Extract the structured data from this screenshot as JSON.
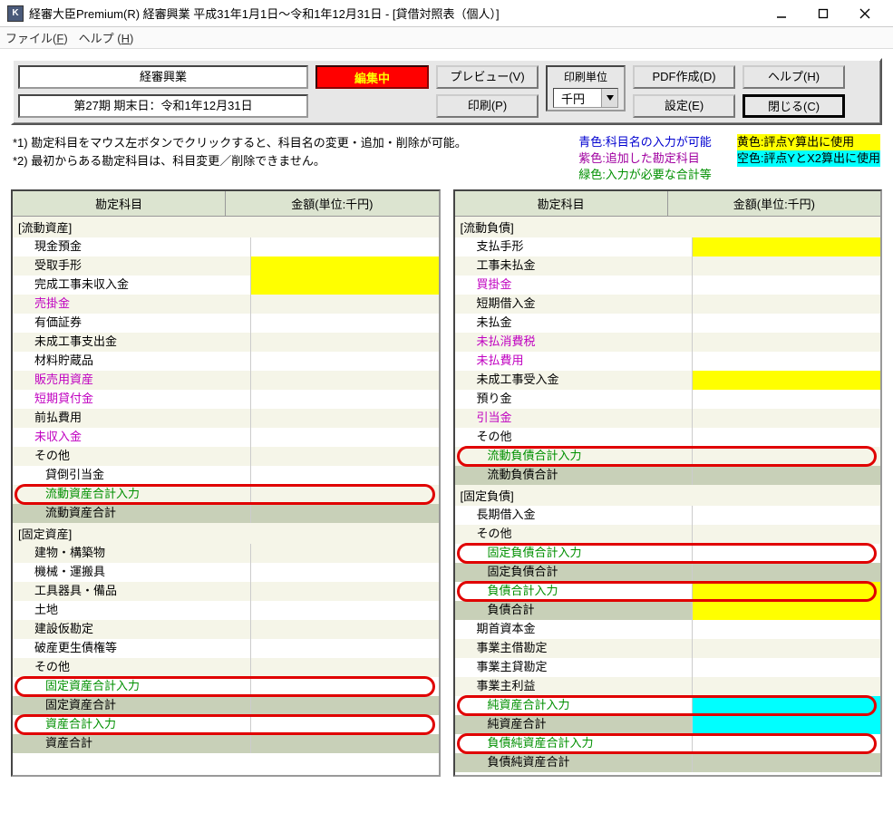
{
  "window": {
    "app_icon_letter": "K",
    "title": "経審大臣Premium(R)   経審興業    平成31年1月1日～令和1年12月31日 - [貸借対照表（個人）]"
  },
  "menubar": {
    "file": "ファイル",
    "file_acc": "F",
    "help": "ヘルプ",
    "help_acc": "H"
  },
  "toolbar": {
    "company": "経審興業",
    "period": "第27期   期末日：令和1年12月31日",
    "editing": "編集中",
    "preview": "プレビュー(V)",
    "print": "印刷(P)",
    "unit_label": "印刷単位",
    "unit_value": "千円",
    "pdf": "PDF作成(D)",
    "settings": "設定(E)",
    "helpbtn": "ヘルプ(H)",
    "close": "閉じる(C)"
  },
  "notes": {
    "n1": "*1) 勘定科目をマウス左ボタンでクリックすると、科目名の変更・追加・削除が可能。",
    "n2": "*2) 最初からある勘定科目は、科目変更／削除できません。"
  },
  "legend": {
    "blue": "青色:科目名の入力が可能",
    "purple": "紫色:追加した勘定科目",
    "green": "緑色:入力が必要な合計等",
    "yellow": "黄色:評点Y算出に使用",
    "cyan": "空色:評点YとX2算出に使用"
  },
  "table_header": {
    "account": "勘定科目",
    "amount": "金額(単位:千円)"
  },
  "left_pane": {
    "sections": [
      {
        "title": "[流動資産]",
        "rows": [
          {
            "label": "現金預金",
            "alt": false
          },
          {
            "label": "受取手形",
            "alt": true,
            "amount_bg": "yellow"
          },
          {
            "label": "完成工事未収入金",
            "alt": false,
            "amount_bg": "yellow"
          },
          {
            "label": "売掛金",
            "alt": true,
            "color": "purple"
          },
          {
            "label": "有価証券",
            "alt": false
          },
          {
            "label": "未成工事支出金",
            "alt": true
          },
          {
            "label": "材料貯蔵品",
            "alt": false
          },
          {
            "label": "販売用資産",
            "alt": true,
            "color": "purple"
          },
          {
            "label": "短期貸付金",
            "alt": false,
            "color": "purple"
          },
          {
            "label": "前払費用",
            "alt": true
          },
          {
            "label": "未収入金",
            "alt": false,
            "color": "purple"
          },
          {
            "label": "その他",
            "alt": true
          },
          {
            "label": "貸倒引当金",
            "alt": false,
            "indent": 2
          },
          {
            "label": "流動資産合計入力",
            "alt": true,
            "color": "green",
            "indent": 2,
            "oval": true
          },
          {
            "label": "流動資産合計",
            "summary": true,
            "indent": 2
          }
        ]
      },
      {
        "title": "[固定資産]",
        "rows": [
          {
            "label": "建物・構築物",
            "alt": true
          },
          {
            "label": "機械・運搬具",
            "alt": false
          },
          {
            "label": "工具器具・備品",
            "alt": true
          },
          {
            "label": "土地",
            "alt": false
          },
          {
            "label": "建設仮勘定",
            "alt": true
          },
          {
            "label": "破産更生債権等",
            "alt": false
          },
          {
            "label": "その他",
            "alt": true
          },
          {
            "label": "固定資産合計入力",
            "alt": false,
            "color": "green",
            "indent": 2,
            "oval": true
          },
          {
            "label": "固定資産合計",
            "summary": true,
            "indent": 2
          },
          {
            "label": "資産合計入力",
            "alt": false,
            "color": "green",
            "indent": 2,
            "oval": true
          },
          {
            "label": "資産合計",
            "summary": true,
            "indent": 2
          }
        ]
      }
    ]
  },
  "right_pane": {
    "sections": [
      {
        "title": "[流動負債]",
        "rows": [
          {
            "label": "支払手形",
            "alt": false,
            "amount_bg": "yellow"
          },
          {
            "label": "工事未払金",
            "alt": true
          },
          {
            "label": "買掛金",
            "alt": false,
            "color": "purple"
          },
          {
            "label": "短期借入金",
            "alt": true
          },
          {
            "label": "未払金",
            "alt": false
          },
          {
            "label": "未払消費税",
            "alt": true,
            "color": "purple"
          },
          {
            "label": "未払費用",
            "alt": false,
            "color": "purple"
          },
          {
            "label": "未成工事受入金",
            "alt": true,
            "amount_bg": "yellow"
          },
          {
            "label": "預り金",
            "alt": false
          },
          {
            "label": "引当金",
            "alt": true,
            "color": "purple"
          },
          {
            "label": "その他",
            "alt": false
          },
          {
            "label": "流動負債合計入力",
            "alt": true,
            "color": "green",
            "indent": 2,
            "oval": true
          },
          {
            "label": "流動負債合計",
            "summary": true,
            "indent": 2
          }
        ]
      },
      {
        "title": "[固定負債]",
        "rows": [
          {
            "label": "長期借入金",
            "alt": false
          },
          {
            "label": "その他",
            "alt": true
          },
          {
            "label": "固定負債合計入力",
            "alt": false,
            "color": "green",
            "indent": 2,
            "oval": true
          },
          {
            "label": "固定負債合計",
            "summary": true,
            "indent": 2
          },
          {
            "label": "負債合計入力",
            "alt": false,
            "color": "green",
            "indent": 2,
            "oval": true,
            "amount_bg": "yellow"
          },
          {
            "label": "負債合計",
            "summary": true,
            "indent": 2,
            "amount_bg": "yellow"
          }
        ]
      },
      {
        "title": "",
        "rows": [
          {
            "label": "期首資本金",
            "alt": false
          },
          {
            "label": "事業主借勘定",
            "alt": true
          },
          {
            "label": "事業主貸勘定",
            "alt": false
          },
          {
            "label": "事業主利益",
            "alt": true
          },
          {
            "label": "純資産合計入力",
            "alt": false,
            "color": "green",
            "indent": 2,
            "oval": true,
            "amount_bg": "cyan"
          },
          {
            "label": "純資産合計",
            "summary": true,
            "indent": 2,
            "amount_bg": "cyan"
          },
          {
            "label": "負債純資産合計入力",
            "alt": false,
            "color": "green",
            "indent": 2,
            "oval": true
          },
          {
            "label": "負債純資産合計",
            "summary": true,
            "indent": 2
          }
        ]
      }
    ]
  }
}
